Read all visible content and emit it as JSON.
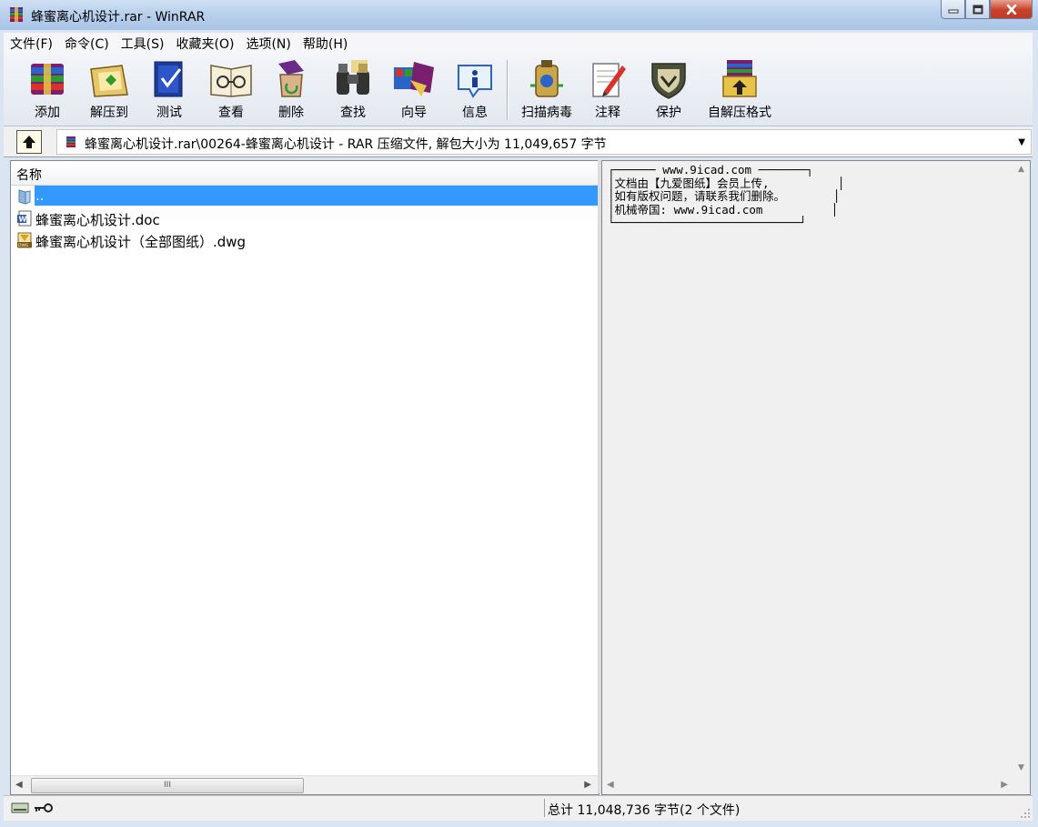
{
  "window": {
    "title": "蜂蜜离心机设计.rar - WinRAR",
    "controls": {
      "minimize": "─",
      "maximize": "□",
      "close": "✕"
    }
  },
  "menu": [
    "文件(F)",
    "命令(C)",
    "工具(S)",
    "收藏夹(O)",
    "选项(N)",
    "帮助(H)"
  ],
  "toolbar": [
    {
      "label": "添加",
      "icon": "add-icon"
    },
    {
      "label": "解压到",
      "icon": "extract-icon"
    },
    {
      "label": "测试",
      "icon": "test-icon"
    },
    {
      "label": "查看",
      "icon": "view-icon"
    },
    {
      "label": "删除",
      "icon": "delete-icon"
    },
    {
      "label": "查找",
      "icon": "find-icon"
    },
    {
      "label": "向导",
      "icon": "wizard-icon"
    },
    {
      "label": "信息",
      "icon": "info-icon"
    },
    {
      "label": "扫描病毒",
      "icon": "scan-virus-icon"
    },
    {
      "label": "注释",
      "icon": "comment-icon"
    },
    {
      "label": "保护",
      "icon": "protect-icon"
    },
    {
      "label": "自解压格式",
      "icon": "sfx-icon"
    }
  ],
  "address": {
    "path": "蜂蜜离心机设计.rar\\00264-蜂蜜离心机设计 - RAR 压缩文件, 解包大小为 11,049,657 字节"
  },
  "filelist": {
    "column_name": "名称",
    "items": [
      {
        "name": "..",
        "icon": "parent-folder-icon",
        "selected": true
      },
      {
        "name": "蜂蜜离心机设计.doc",
        "icon": "word-doc-icon",
        "selected": false
      },
      {
        "name": "蜂蜜离心机设计（全部图纸）.dwg",
        "icon": "dwg-file-icon",
        "selected": false
      }
    ],
    "scroll_grip": "III"
  },
  "comment": {
    "lines": [
      "┌────── www.9icad.com ───────┐",
      "│文档由【九爱图纸】会员上传,          │",
      "│如有版权问题，请联系我们删除。       │",
      "│机械帝国: www.9icad.com          │",
      "└───────────────────────────┘"
    ]
  },
  "status": {
    "total": "总计 11,048,736 字节(2 个文件)"
  },
  "colors": {
    "selection": "#3399ff",
    "titlebar": "#b9d1ec",
    "close_button": "#c7412a"
  }
}
